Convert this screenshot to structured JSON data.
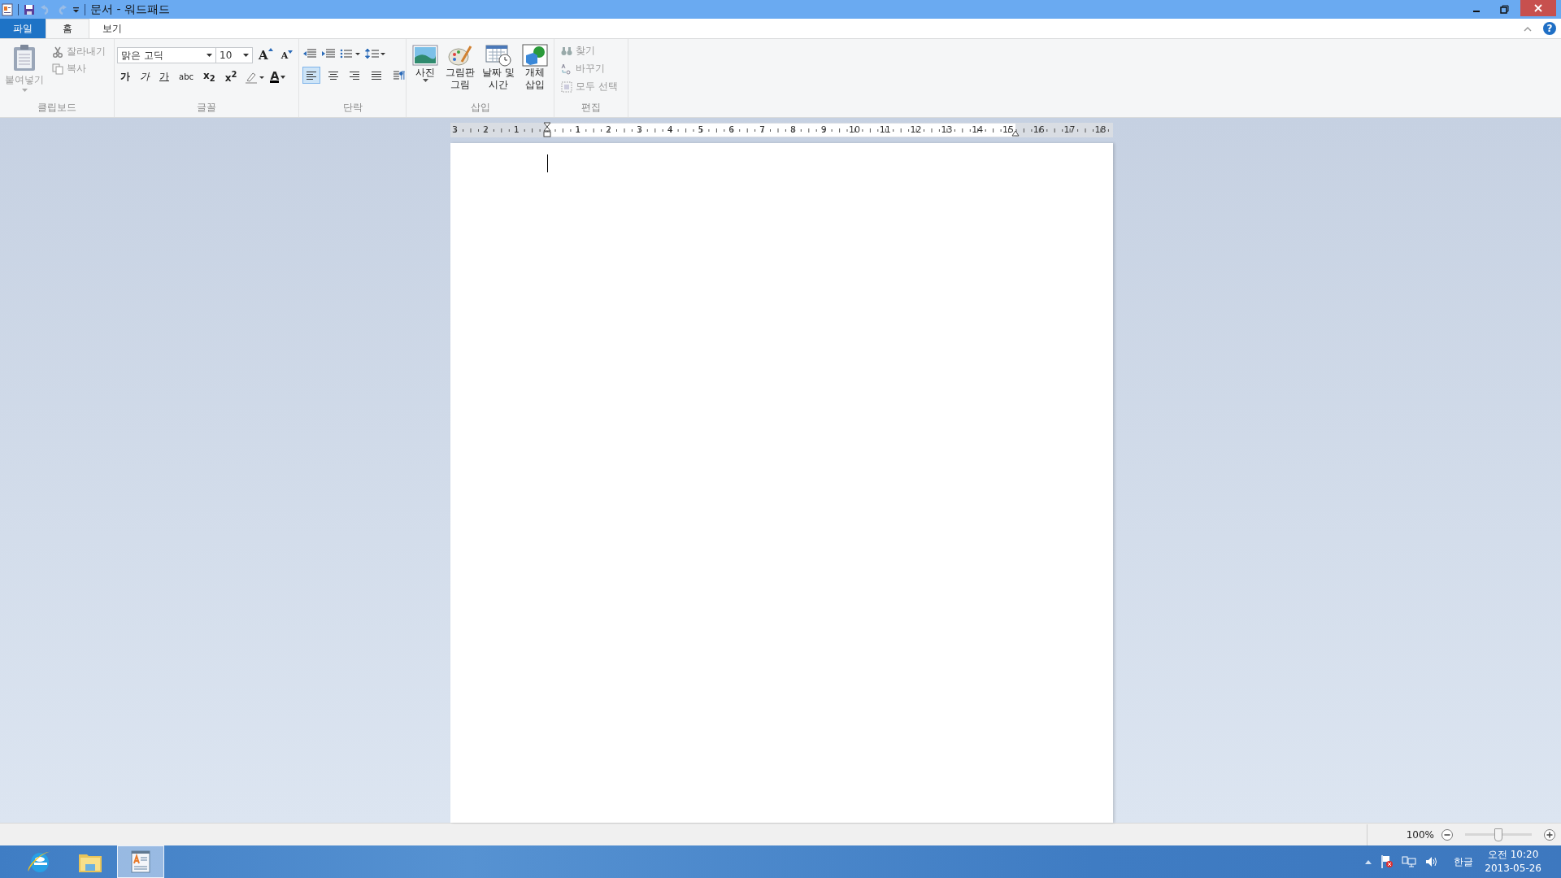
{
  "title_bar": {
    "title": "문서 - 워드패드"
  },
  "tabs": [
    {
      "label": "파일",
      "kind": "file",
      "selected": false
    },
    {
      "label": "홈",
      "kind": "tab",
      "selected": true
    },
    {
      "label": "보기",
      "kind": "tab",
      "selected": false
    }
  ],
  "help_button": "?",
  "clipboard": {
    "label": "클립보드",
    "paste": {
      "label": "붙여넣기",
      "disabled": true
    },
    "cut": {
      "label": "잘라내기",
      "disabled": true
    },
    "copy": {
      "label": "복사",
      "disabled": true
    }
  },
  "font": {
    "label": "글꼴",
    "font_name": "맑은 고딕",
    "font_size": "10",
    "grow": "A",
    "shrink": "A",
    "format_buttons": [
      {
        "kind": "bold",
        "text": "가"
      },
      {
        "kind": "italic",
        "text": "가"
      },
      {
        "kind": "underline",
        "text": "가"
      },
      {
        "kind": "strike",
        "text": "abc"
      },
      {
        "kind": "sub",
        "text": "x$_{2}$"
      },
      {
        "kind": "sup",
        "text": "x$^{2}$"
      }
    ],
    "color_button": "A"
  },
  "paragraph": {
    "label": "단락",
    "alignments": [
      {
        "kind": "left",
        "selected": true
      },
      {
        "kind": "center",
        "selected": false
      },
      {
        "kind": "right",
        "selected": false
      },
      {
        "kind": "justify",
        "selected": false
      }
    ]
  },
  "insert": {
    "label": "삽입",
    "buttons": [
      {
        "kind": "photo",
        "lines": [
          "사진"
        ]
      },
      {
        "kind": "paint",
        "lines": [
          "그림판",
          "그림"
        ]
      },
      {
        "kind": "datetime",
        "lines": [
          "날짜 및",
          "시간"
        ]
      },
      {
        "kind": "object",
        "lines": [
          "개체",
          "삽입"
        ]
      }
    ]
  },
  "editing": {
    "label": "편집",
    "items": [
      {
        "kind": "find",
        "label": "찾기",
        "disabled": true
      },
      {
        "kind": "replace",
        "label": "바꾸기",
        "disabled": true
      },
      {
        "kind": "selectall",
        "label": "모두 선택",
        "disabled": true
      }
    ]
  },
  "ruler": {
    "left_labels": [
      "3",
      "2",
      "1"
    ],
    "right_labels": [
      "1",
      "2",
      "3",
      "4",
      "5",
      "6",
      "7",
      "8",
      "9",
      "10",
      "11",
      "12",
      "13",
      "14",
      "15",
      "16",
      "17",
      "18"
    ]
  },
  "status_bar": {
    "zoom": "100%",
    "zoom_level": {
      "level": 0.5
    }
  },
  "taskbar": {
    "apps": [
      {
        "kind": "ie",
        "selected": false
      },
      {
        "kind": "folder",
        "selected": false
      },
      {
        "kind": "wordpad",
        "selected": true
      }
    ],
    "tray": {
      "language": "한글",
      "time": "오전 10:20",
      "date": "2013-05-26"
    }
  }
}
